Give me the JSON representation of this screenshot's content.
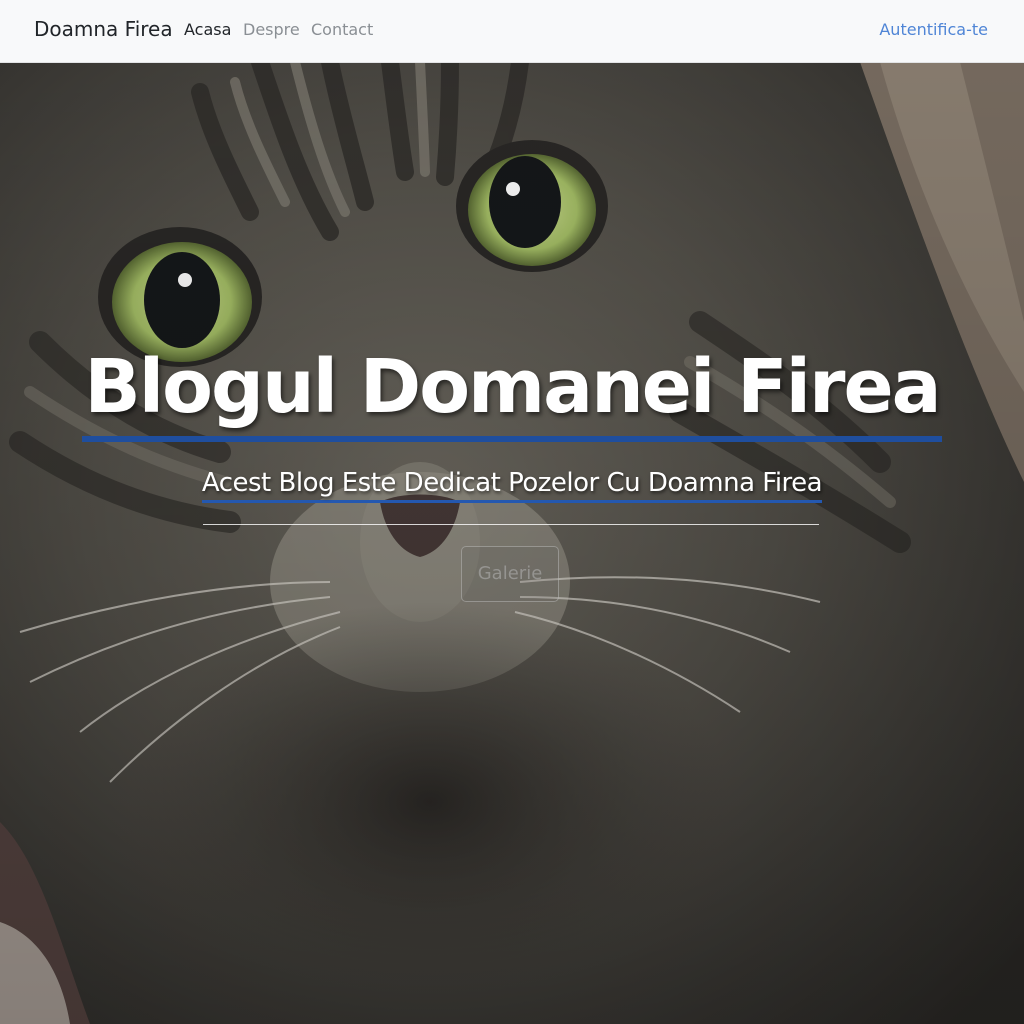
{
  "navbar": {
    "brand": "Doamna Firea",
    "links": [
      {
        "label": "Acasa",
        "active": true
      },
      {
        "label": "Despre",
        "active": false
      },
      {
        "label": "Contact",
        "active": false
      }
    ],
    "login_label": "Autentifica-te"
  },
  "hero": {
    "title": "Blogul Domanei Firea",
    "subtitle": "Acest Blog Este Dedicat Pozelor Cu Doamna Firea",
    "button_label": "Galerie",
    "image_subject": "tabby cat with green eyes (close-up)"
  },
  "colors": {
    "navbar_bg": "#f8f9fa",
    "link_accent": "#4f85d6",
    "title_underline": "#1f4e9e",
    "eye_green": "#a9c46a"
  }
}
